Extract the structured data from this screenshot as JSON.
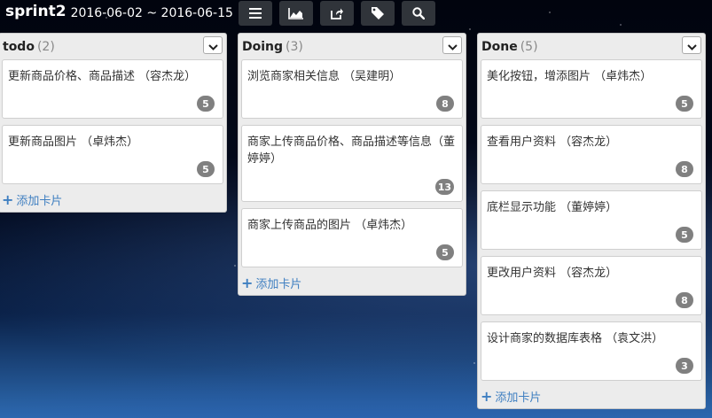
{
  "header": {
    "title": "sprint2",
    "dates": "2016-06-02 ~ 2016-06-15",
    "toolbar_icons": [
      "menu-icon",
      "chart-icon",
      "share-icon",
      "tag-icon",
      "search-icon"
    ]
  },
  "lists": [
    {
      "title": "todo",
      "count": "(2)",
      "cards": [
        {
          "text": "更新商品价格、商品描述 （容杰龙）",
          "points": "5"
        },
        {
          "text": "更新商品图片 （卓炜杰）",
          "points": "5"
        }
      ],
      "add_label": "添加卡片"
    },
    {
      "title": "Doing",
      "count": "(3)",
      "cards": [
        {
          "text": "浏览商家相关信息 （吴建明）",
          "points": "8"
        },
        {
          "text": "商家上传商品价格、商品描述等信息（董婷婷）",
          "points": "13"
        },
        {
          "text": "商家上传商品的图片 （卓炜杰）",
          "points": "5"
        }
      ],
      "add_label": "添加卡片"
    },
    {
      "title": "Done",
      "count": "(5)",
      "cards": [
        {
          "text": "美化按钮，增添图片 （卓炜杰）",
          "points": "5"
        },
        {
          "text": "查看用户资料 （容杰龙）",
          "points": "8"
        },
        {
          "text": "底栏显示功能 （董婷婷）",
          "points": "5"
        },
        {
          "text": "更改用户资料 （容杰龙）",
          "points": "8"
        },
        {
          "text": "设计商家的数据库表格 （袁文洪）",
          "points": "3"
        }
      ],
      "add_label": "添加卡片"
    }
  ]
}
